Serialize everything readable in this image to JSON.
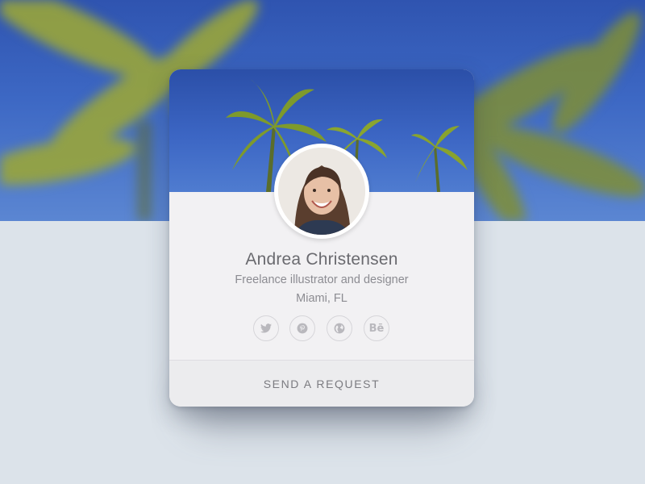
{
  "profile": {
    "name": "Andrea Christensen",
    "role": "Freelance illustrator and designer",
    "location": "Miami, FL"
  },
  "socials": [
    {
      "icon": "twitter-icon"
    },
    {
      "icon": "pinterest-icon"
    },
    {
      "icon": "globe-icon"
    },
    {
      "icon": "behance-icon",
      "label": "Bē"
    }
  ],
  "cta": {
    "label": "SEND A REQUEST"
  },
  "colors": {
    "sky": "#3c66c4",
    "card": "#f2f1f3",
    "page": "#dce3ea",
    "text": "#6a6a6f"
  }
}
